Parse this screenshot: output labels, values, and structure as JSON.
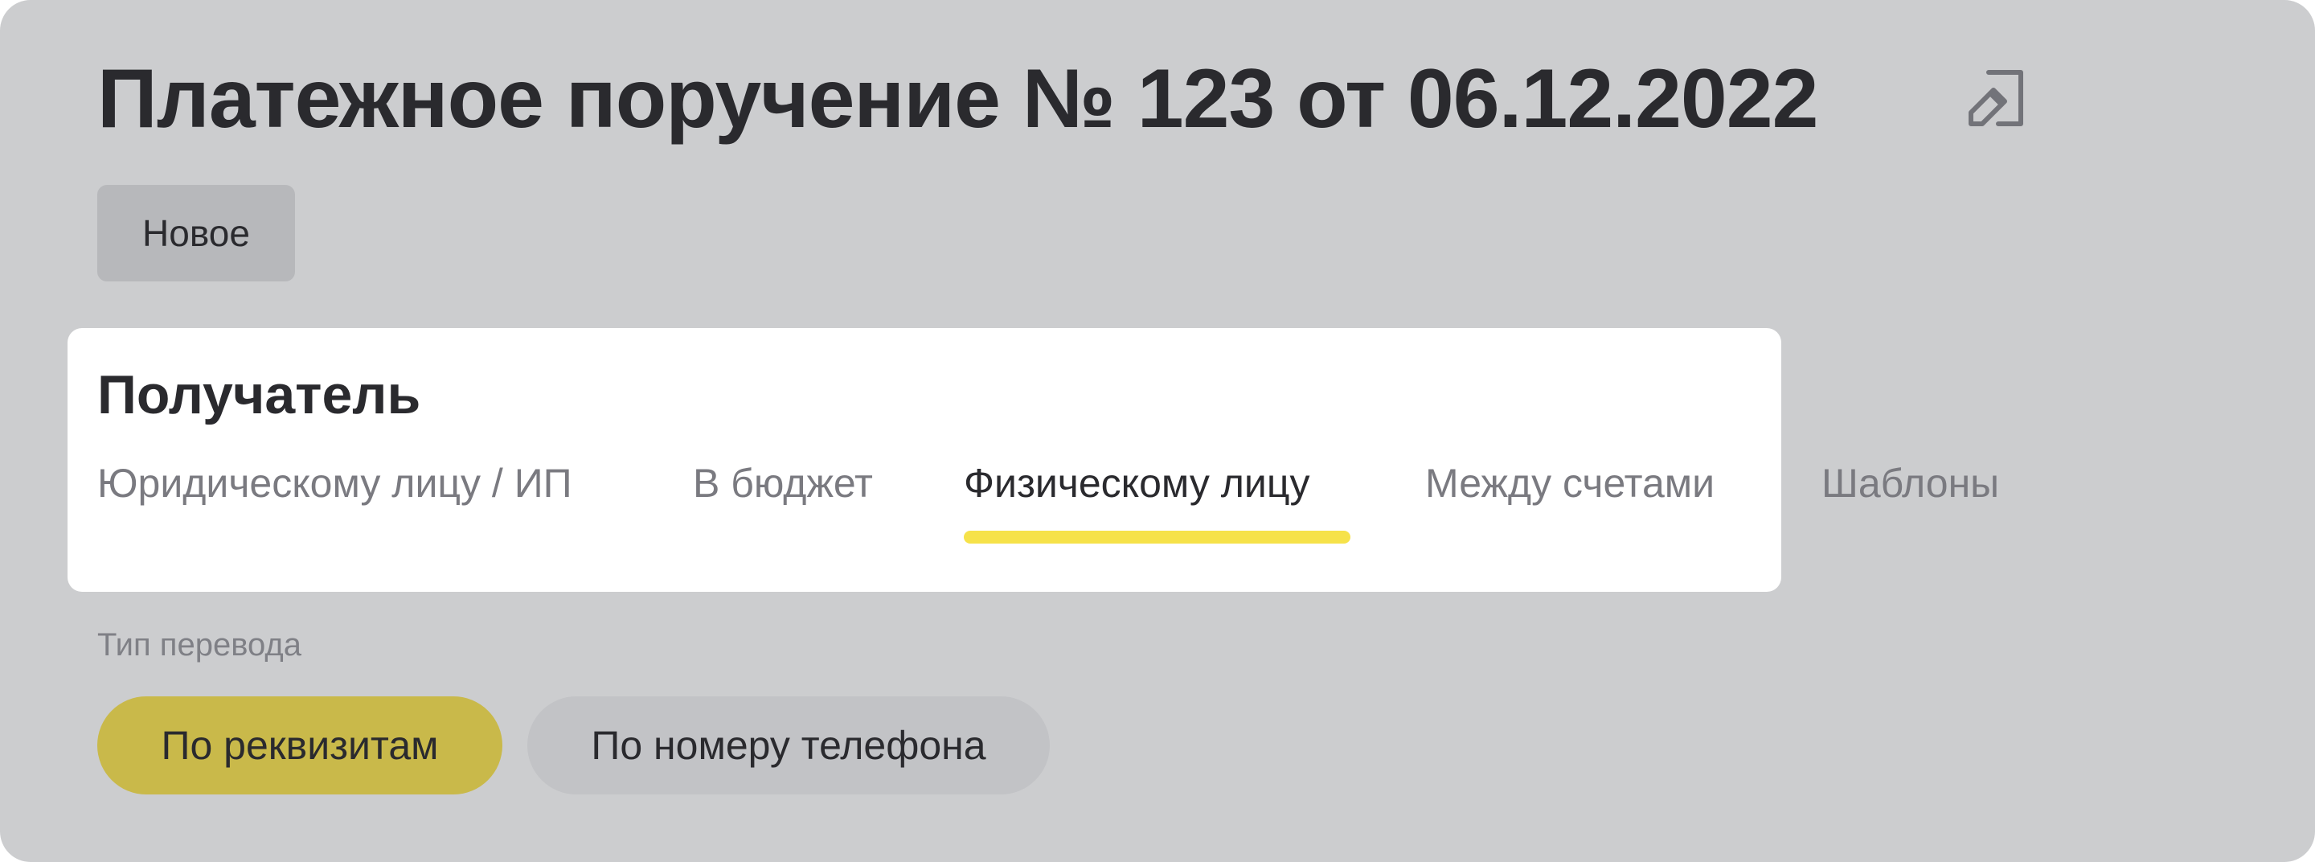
{
  "header": {
    "title": "Платежное поручение № 123 от 06.12.2022",
    "edit_icon": "edit-icon"
  },
  "status": {
    "label": "Новое"
  },
  "recipient": {
    "title": "Получатель",
    "tabs": [
      {
        "label": "Юридическому лицу / ИП",
        "active": false
      },
      {
        "label": "В бюджет",
        "active": false
      },
      {
        "label": "Физическому лицу",
        "active": true
      },
      {
        "label": "Между счетами",
        "active": false
      },
      {
        "label": "Шаблоны",
        "active": false
      }
    ]
  },
  "transfer_type": {
    "label": "Тип перевода",
    "options": [
      {
        "label": "По реквизитам",
        "selected": true
      },
      {
        "label": "По номеру телефона",
        "selected": false
      }
    ]
  },
  "colors": {
    "background": "#cccdcf",
    "card": "#ffffff",
    "accent_underline": "#f6e24a",
    "selected_pill": "#c9b94a",
    "text_primary": "#2a2a2e",
    "text_muted": "#7a7a80"
  }
}
